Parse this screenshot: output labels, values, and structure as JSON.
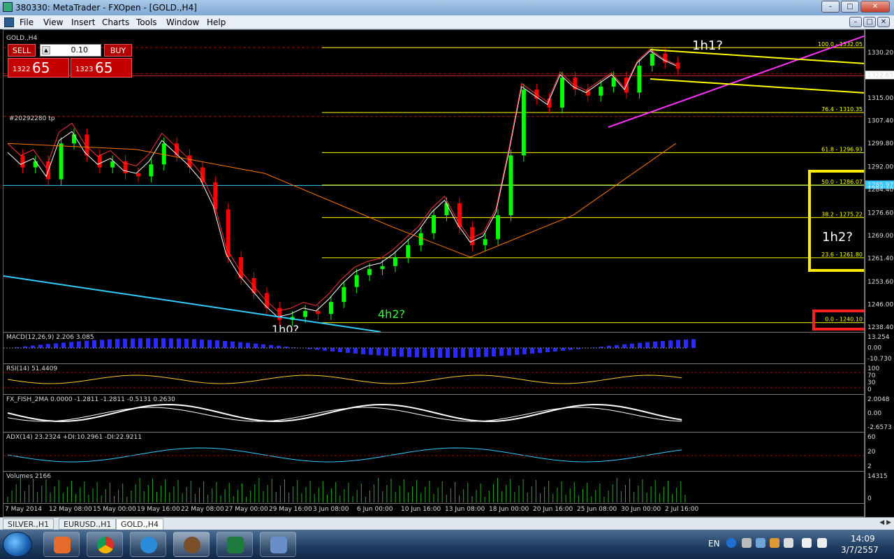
{
  "window": {
    "title": "380330: MetaTrader - FXOpen - [GOLD.,H4]"
  },
  "menu": [
    "File",
    "View",
    "Insert",
    "Charts",
    "Tools",
    "Window",
    "Help"
  ],
  "chart": {
    "symbol_label": "GOLD.,H4",
    "order_label": "#20292280 tp",
    "sell_label": "SELL",
    "buy_label": "BUY",
    "lot": "0.10",
    "sell_price_small": "1322",
    "sell_price_big": "65",
    "buy_price_small": "1323",
    "buy_price_big": "65",
    "annotations": [
      "1h1?",
      "1h2?",
      "4h2?",
      "1h0?"
    ],
    "fib_levels": [
      {
        "label": "100.0 - 1332.05",
        "price": 1332.05
      },
      {
        "label": "76.4 - 1310.35",
        "price": 1310.35
      },
      {
        "label": "61.8 - 1296.93",
        "price": 1296.93
      },
      {
        "label": "50.0 - 1286.07",
        "price": 1286.07
      },
      {
        "label": "38.2 - 1275.22",
        "price": 1275.22
      },
      {
        "label": "23.6 - 1261.80",
        "price": 1261.8
      },
      {
        "label": "0.0 - 1240.10",
        "price": 1240.1
      }
    ],
    "price_axis": [
      "1330.20",
      "1322.65",
      "1315.00",
      "1307.40",
      "1299.80",
      "1292.00",
      "1285.97",
      "1284.40",
      "1276.60",
      "1269.00",
      "1261.40",
      "1253.60",
      "1246.00",
      "1238.40"
    ],
    "current_price": "1322.65",
    "cyan_price": "1285.97",
    "time_axis": [
      "7 May 2014",
      "12 May 08:00",
      "15 May 00:00",
      "19 May 16:00",
      "22 May 08:00",
      "27 May 00:00",
      "29 May 16:00",
      "3 Jun 08:00",
      "6 Jun 00:00",
      "10 Jun 16:00",
      "13 Jun 08:00",
      "18 Jun 00:00",
      "20 Jun 16:00",
      "25 Jun 08:00",
      "30 Jun 00:00",
      "2 Jul 16:00"
    ]
  },
  "indicators": [
    {
      "title": "MACD(12,26,9) 2.206 3.085",
      "levels": [
        "13.254",
        "0.00",
        "-10.730"
      ]
    },
    {
      "title": "RSI(14) 51.4409",
      "levels": [
        "100",
        "70",
        "30",
        "0"
      ]
    },
    {
      "title": "FX_FISH_2MA 0.0000 -1.2811 -1.2811 -0.5131 0.2630",
      "levels": [
        "2.0048",
        "0.00",
        "-2.6573"
      ]
    },
    {
      "title": "ADX(14) 23.2324 +DI:10.2961 -DI:22.9211",
      "levels": [
        "60",
        "20",
        "2"
      ]
    },
    {
      "title": "Volumes 2166",
      "levels": [
        "14315",
        "0"
      ]
    }
  ],
  "tabs": [
    "SILVER.,H1",
    "EURUSD.,H1",
    "GOLD.,H4"
  ],
  "active_tab": "GOLD.,H4",
  "tray": {
    "lang": "EN",
    "time": "14:09",
    "date": "3/7/2557"
  },
  "colors": {
    "candle_up": "#00ff00",
    "candle_down": "#ff0000",
    "fib": "#ffff00",
    "trend_magenta": "#ff33ff",
    "cyan": "#33ccff",
    "highlight_yellow": "#ffee00",
    "highlight_red": "#ff2020"
  }
}
